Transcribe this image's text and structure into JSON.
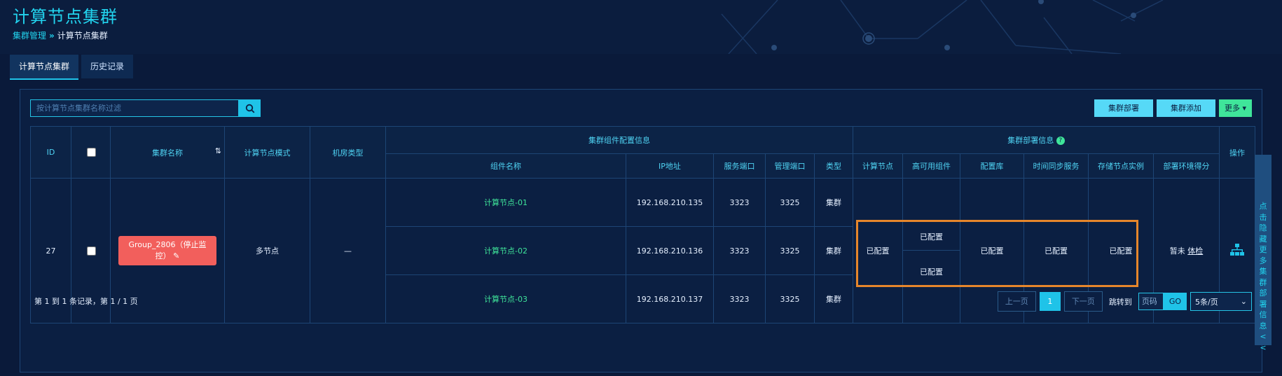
{
  "page": {
    "title": "计算节点集群",
    "breadcrumb": {
      "parent": "集群管理",
      "separator": "»",
      "current": "计算节点集群"
    }
  },
  "tabs": [
    {
      "label": "计算节点集群",
      "active": true
    },
    {
      "label": "历史记录",
      "active": false
    }
  ],
  "search": {
    "placeholder": "按计算节点集群名称过滤",
    "value": ""
  },
  "toolbar": {
    "deploy_label": "集群部署",
    "add_label": "集群添加",
    "more_label": "更多"
  },
  "table": {
    "headers": {
      "id": "ID",
      "name": "集群名称",
      "mode": "计算节点模式",
      "room": "机房类型",
      "component_group": "集群组件配置信息",
      "deploy_group": "集群部署信息",
      "ops": "操作",
      "component_cols": [
        "组件名称",
        "IP地址",
        "服务端口",
        "管理端口",
        "类型"
      ],
      "deploy_cols": [
        "计算节点",
        "高可用组件",
        "配置库",
        "时间同步服务",
        "存储节点实例",
        "部署环境得分"
      ]
    },
    "row": {
      "id": "27",
      "group_name": "Group_2806（停止监控）",
      "mode": "多节点",
      "room": "—",
      "components": [
        {
          "name": "计算节点-01",
          "ip": "192.168.210.135",
          "service_port": "3323",
          "manage_port": "3325",
          "type": "集群"
        },
        {
          "name": "计算节点-02",
          "ip": "192.168.210.136",
          "service_port": "3323",
          "manage_port": "3325",
          "type": "集群"
        },
        {
          "name": "计算节点-03",
          "ip": "192.168.210.137",
          "service_port": "3323",
          "manage_port": "3325",
          "type": "集群"
        }
      ],
      "deploy": {
        "compute": "已配置",
        "ha": [
          "已配置",
          "已配置"
        ],
        "config_db": "已配置",
        "time_sync": "已配置",
        "storage": "已配置",
        "score_text": "暂未",
        "score_link": "体检"
      }
    }
  },
  "pagination": {
    "summary": "第 1 到 1 条记录，第 1 / 1 页",
    "prev": "上一页",
    "current": "1",
    "next": "下一页",
    "jump_label": "跳转到",
    "page_placeholder": "页码",
    "go": "GO",
    "page_size": "5条/页"
  },
  "side_panel": {
    "label": "点击隐藏更多集群部署信息<<"
  },
  "colors": {
    "accent": "#1fc3e8",
    "danger": "#f25f5c",
    "success": "#3fe59a",
    "highlight": "#e6862b"
  }
}
